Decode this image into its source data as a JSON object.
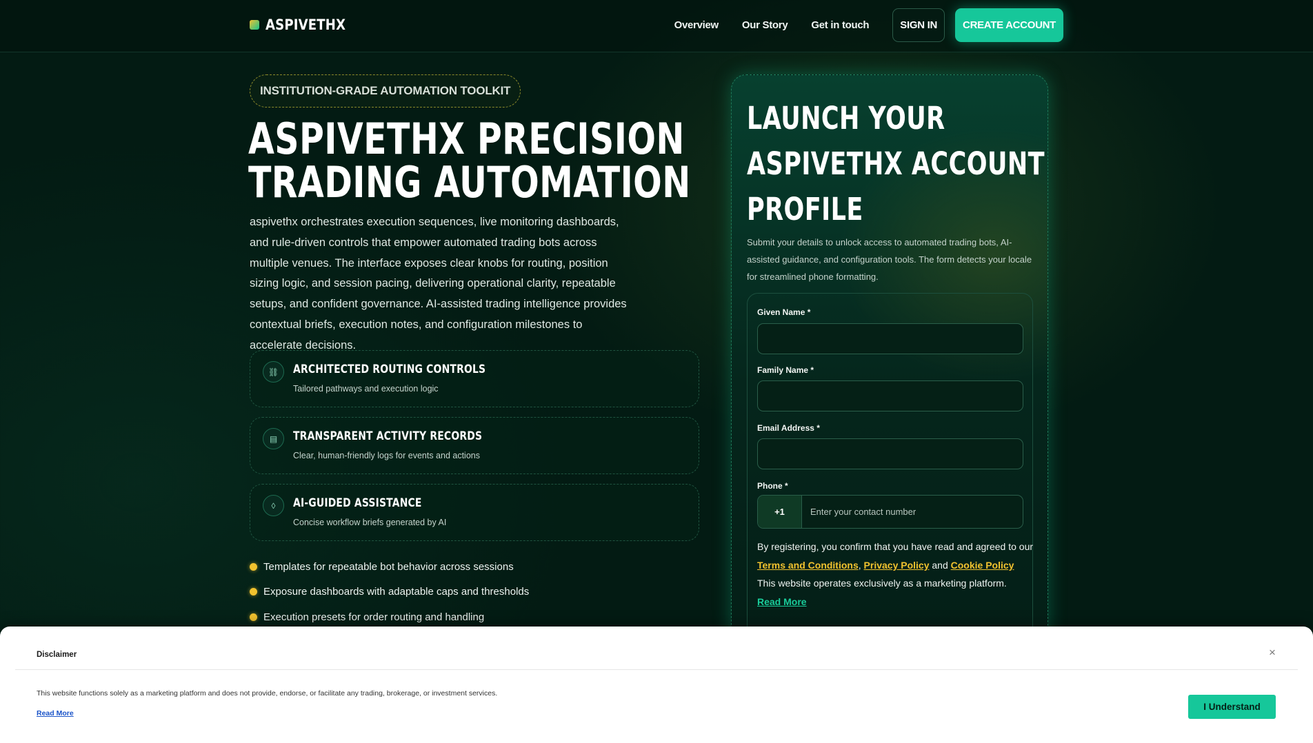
{
  "header": {
    "brand": "ASPIVETHX",
    "nav": [
      "Overview",
      "Our Story",
      "Get in touch"
    ],
    "sign_in": "SIGN IN",
    "create_account": "CREATE ACCOUNT"
  },
  "hero": {
    "badge": "INSTITUTION-GRADE AUTOMATION TOOLKIT",
    "title_lines": [
      "ASPIVETHX PRECISION",
      "TRADING AUTOMATION"
    ],
    "description": "aspivethx orchestrates execution sequences, live monitoring dashboards, and rule-driven controls that empower automated trading bots across multiple venues. The interface exposes clear knobs for routing, position sizing logic, and session pacing, delivering operational clarity, repeatable setups, and confident governance. AI-assisted trading intelligence provides contextual briefs, execution notes, and configuration milestones to accelerate decisions."
  },
  "features": [
    {
      "icon": "link-icon",
      "glyph": "⛓",
      "title": "ARCHITECTED ROUTING CONTROLS",
      "subtitle": "Tailored pathways and execution logic"
    },
    {
      "icon": "list-icon",
      "glyph": "▤",
      "title": "TRANSPARENT ACTIVITY RECORDS",
      "subtitle": "Clear, human-friendly logs for events and actions"
    },
    {
      "icon": "ai-spark-icon",
      "glyph": "◊",
      "title": "AI-GUIDED ASSISTANCE",
      "subtitle": "Concise workflow briefs generated by AI"
    }
  ],
  "bullets": [
    "Templates for repeatable bot behavior across sessions",
    "Exposure dashboards with adaptable caps and thresholds",
    "Execution presets for order routing and handling"
  ],
  "signup": {
    "title_lines": [
      "LAUNCH YOUR",
      "ASPIVETHX ACCOUNT",
      "PROFILE"
    ],
    "description": "Submit your details to unlock access to automated trading bots, AI-assisted guidance, and configuration tools. The form detects your locale for streamlined phone formatting.",
    "fields": {
      "given_name": {
        "label": "Given Name *",
        "value": ""
      },
      "family_name": {
        "label": "Family Name *",
        "value": ""
      },
      "email": {
        "label": "Email Address *",
        "value": ""
      },
      "phone": {
        "label": "Phone *",
        "code": "+1",
        "placeholder": "Enter your contact number",
        "value": ""
      }
    },
    "consent": {
      "prefix": "By registering, you confirm that you have read and agreed to our",
      "terms": "Terms and Conditions",
      "comma": ",",
      "privacy": "Privacy Policy",
      "and": "and",
      "cookie": "Cookie Policy",
      "note": "This website operates exclusively as a marketing platform.",
      "read_more": "Read More"
    }
  },
  "disclaimer": {
    "title": "Disclaimer",
    "close": "×",
    "text": "This website functions solely as a marketing platform and does not provide, endorse, or facilitate any trading, brokerage, or investment services.",
    "read_more": "Read More",
    "button": "I Understand"
  },
  "colors": {
    "background": "#031b13",
    "accent": "#16c79a",
    "gold": "#f2c22e",
    "link_blue": "#1a53c8"
  }
}
